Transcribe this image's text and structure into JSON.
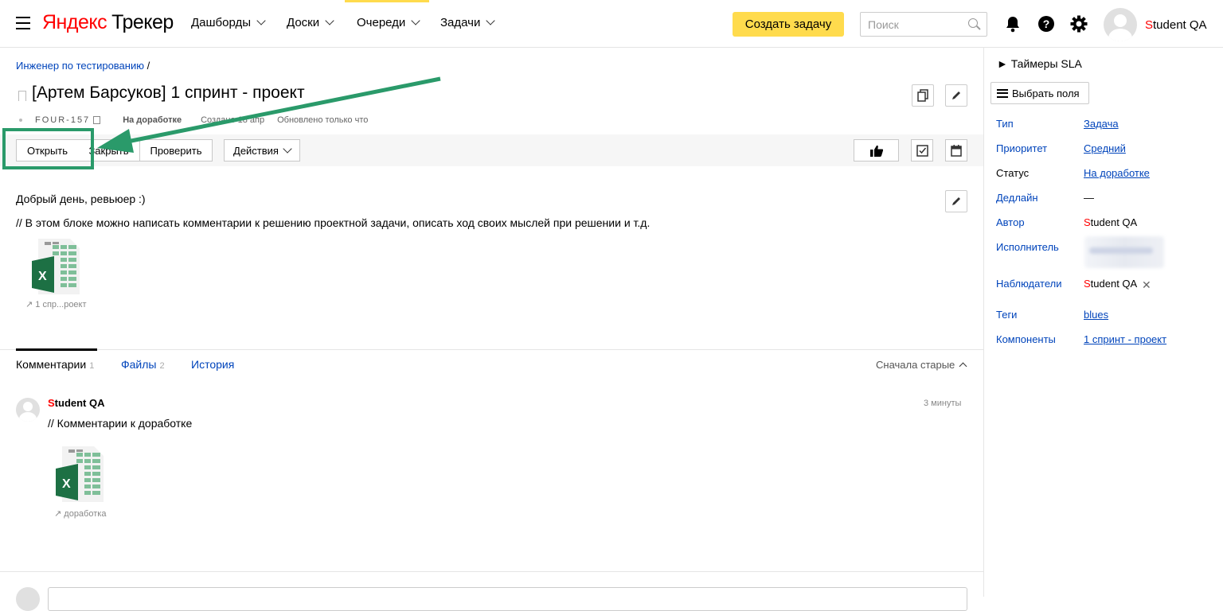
{
  "header": {
    "logo_brand": "Яндекс",
    "logo_product": "Трекер",
    "nav": [
      "Дашборды",
      "Доски",
      "Очереди",
      "Задачи"
    ],
    "create_button": "Создать задачу",
    "search_placeholder": "Поиск",
    "user": {
      "initial": "S",
      "rest": "tudent QA"
    }
  },
  "issue": {
    "breadcrumb": "Инженер по тестированию",
    "breadcrumb_sep": "/",
    "title": "[Артем Барсуков] 1 спринт - проект",
    "key": "FOUR-157",
    "status": "На доработке",
    "created": "Создано 18 апр",
    "updated": "Обновлено только что"
  },
  "toolbar": {
    "open": "Открыть",
    "close": "Закрыть",
    "check": "Проверить",
    "actions": "Действия"
  },
  "description": {
    "line1": "Добрый день, ревьюер :)",
    "line2": "// В этом блоке можно написать комментарии к решению проектной задачи, описать ход своих мыслей при решении и т.д.",
    "attachment_label": "1 спр...роект"
  },
  "tabs": {
    "comments": "Комментарии",
    "comments_count": "1",
    "files": "Файлы",
    "files_count": "2",
    "history": "История",
    "sort": "Сначала старые"
  },
  "comment": {
    "author_initial": "S",
    "author_rest": "tudent QA",
    "time": "3 минуты",
    "text": "// Комментарии к доработке",
    "attachment_label": "доработка"
  },
  "sidebar": {
    "sla": "► Таймеры SLA",
    "choose_fields": "Выбрать поля",
    "fields": [
      {
        "label": "Тип",
        "value": "Задача"
      },
      {
        "label": "Приоритет",
        "value": "Средний"
      },
      {
        "label": "Статус",
        "value": "На доработке"
      },
      {
        "label": "Дедлайн",
        "value": "—"
      },
      {
        "label": "Автор",
        "value_initial": "S",
        "value_rest": "tudent QA"
      },
      {
        "label": "Исполнитель",
        "value": ""
      },
      {
        "label": "Наблюдатели",
        "value_initial": "S",
        "value_rest": "tudent QA"
      },
      {
        "label": "Теги",
        "value": "blues"
      },
      {
        "label": "Компоненты",
        "value": "1 спринт - проект"
      }
    ]
  },
  "colors": {
    "accent_yellow": "#ffdb4d",
    "link_blue": "#0044bb",
    "annotation_green": "#2a9a6a",
    "excel_green": "#1d7044"
  },
  "icons": [
    "menu-icon",
    "chevron-down-icon",
    "search-icon",
    "bell-icon",
    "help-icon",
    "gear-icon",
    "bookmark-icon",
    "copy-icon",
    "edit-icon",
    "thumbs-up-icon",
    "checkbox-icon",
    "calendar-icon",
    "excel-file-icon",
    "external-link-icon",
    "close-icon",
    "choose-fields-icon"
  ]
}
